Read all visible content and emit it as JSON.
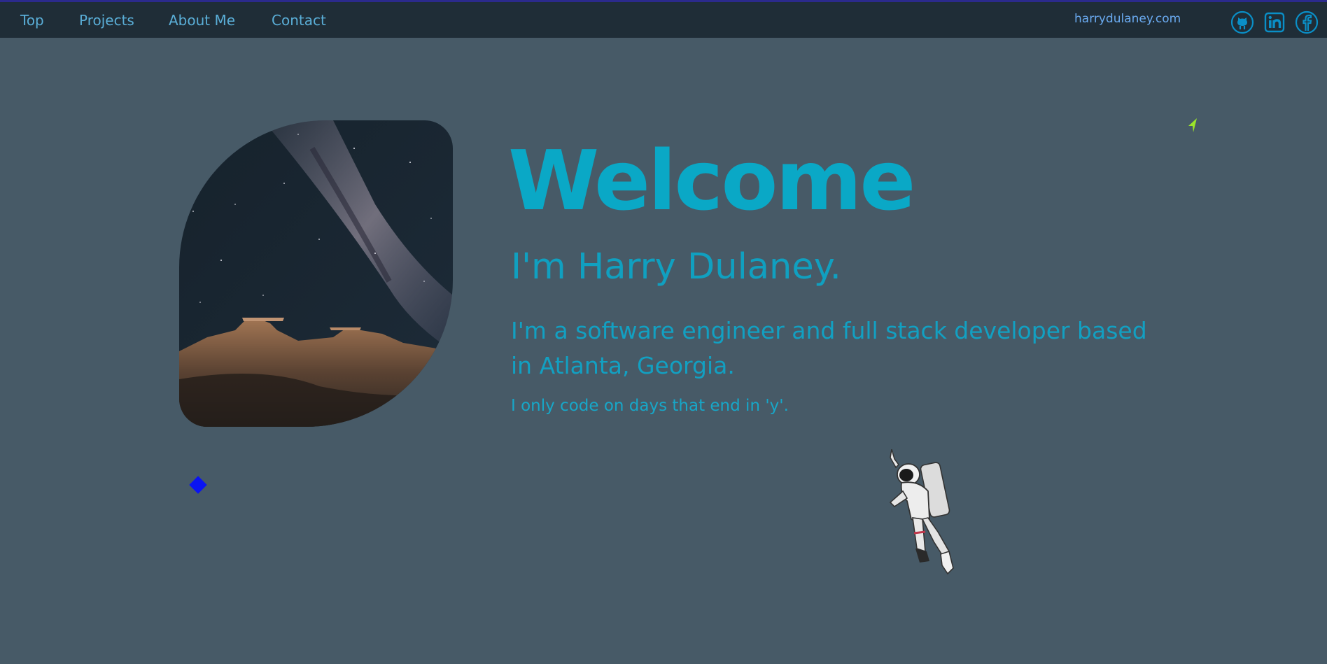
{
  "nav": {
    "links": [
      {
        "label": "Top"
      },
      {
        "label": "Projects"
      },
      {
        "label": "About Me"
      },
      {
        "label": "Contact"
      }
    ],
    "brand": "harrydulaney.com",
    "social_icons": [
      "github-icon",
      "linkedin-icon",
      "facebook-icon"
    ]
  },
  "hero": {
    "title": "Welcome",
    "subtitle": "I'm Harry Dulaney.",
    "description": "I'm a software engineer and full stack developer based in Atlanta, Georgia.",
    "tagline": "I only code on days that end in 'y'."
  },
  "colors": {
    "background": "#475a67",
    "navbar": "#1f2d37",
    "accent": "#0aa8c6",
    "nav_link": "#5aaed7",
    "brand_link": "#6aaaf0",
    "diamond": "#0a14f2",
    "arrow": "#9be52a"
  }
}
